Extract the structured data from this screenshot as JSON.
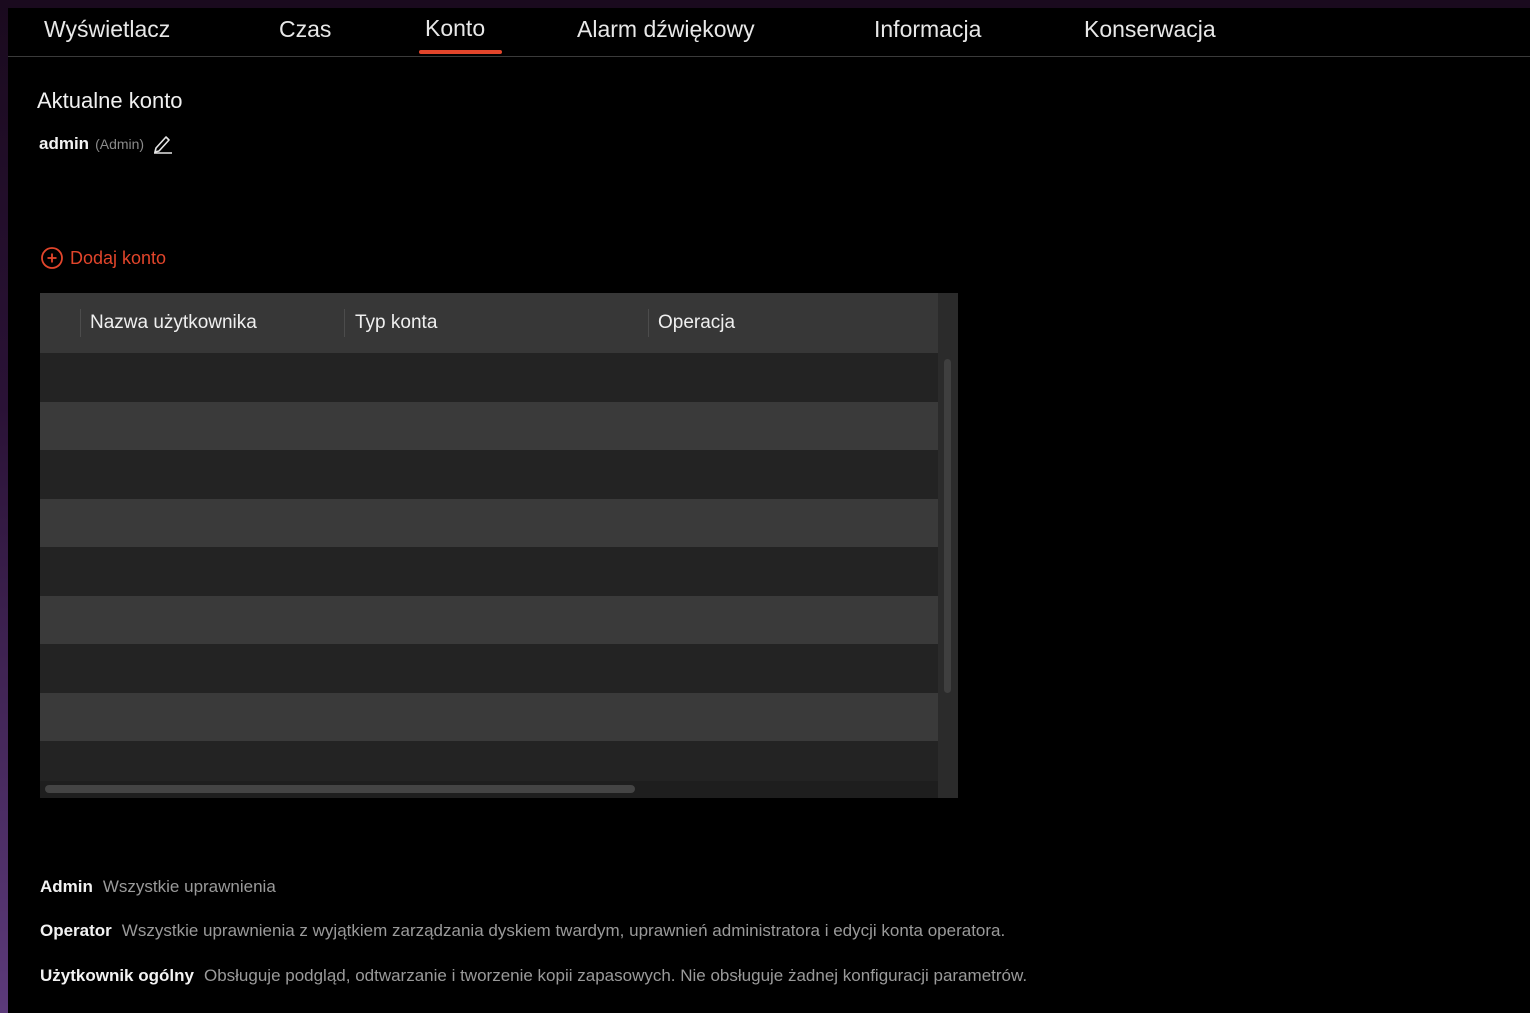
{
  "tabs": [
    {
      "label": "Wyświetlacz"
    },
    {
      "label": "Czas"
    },
    {
      "label": "Konto",
      "active": true
    },
    {
      "label": "Alarm dźwiękowy"
    },
    {
      "label": "Informacja"
    },
    {
      "label": "Konserwacja"
    }
  ],
  "current_account": {
    "title": "Aktualne konto",
    "username": "admin",
    "role": "(Admin)"
  },
  "add_account": {
    "label": "Dodaj konto"
  },
  "table": {
    "headers": [
      "Nazwa użytkownika",
      "Typ konta",
      "Operacja"
    ],
    "rows": []
  },
  "legend": [
    {
      "key": "Admin",
      "desc": "Wszystkie uprawnienia"
    },
    {
      "key": "Operator",
      "desc": "Wszystkie uprawnienia z wyjątkiem zarządzania dyskiem twardym, uprawnień administratora i edycji konta operatora."
    },
    {
      "key": "Użytkownik ogólny",
      "desc": "Obsługuje podgląd, odtwarzanie i tworzenie kopii zapasowych. Nie obsługuje żadnej konfiguracji parametrów."
    }
  ],
  "colors": {
    "accent": "#e2452b",
    "background": "#000000",
    "header_bg": "#373737",
    "row_dark": "#232323",
    "row_light": "#3a3a3a"
  },
  "icons": {
    "edit": "pencil-icon",
    "add": "plus-circle-icon"
  }
}
